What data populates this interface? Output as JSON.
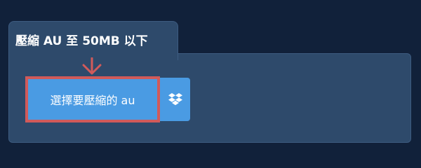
{
  "section": {
    "tab_title": "壓縮 AU 至 50MB 以下"
  },
  "upload": {
    "button_label": "選擇要壓縮的 au",
    "highlight_color": "#d15a5a",
    "button_color": "#4a9be3"
  },
  "cloud": {
    "icon": "dropbox-icon"
  }
}
